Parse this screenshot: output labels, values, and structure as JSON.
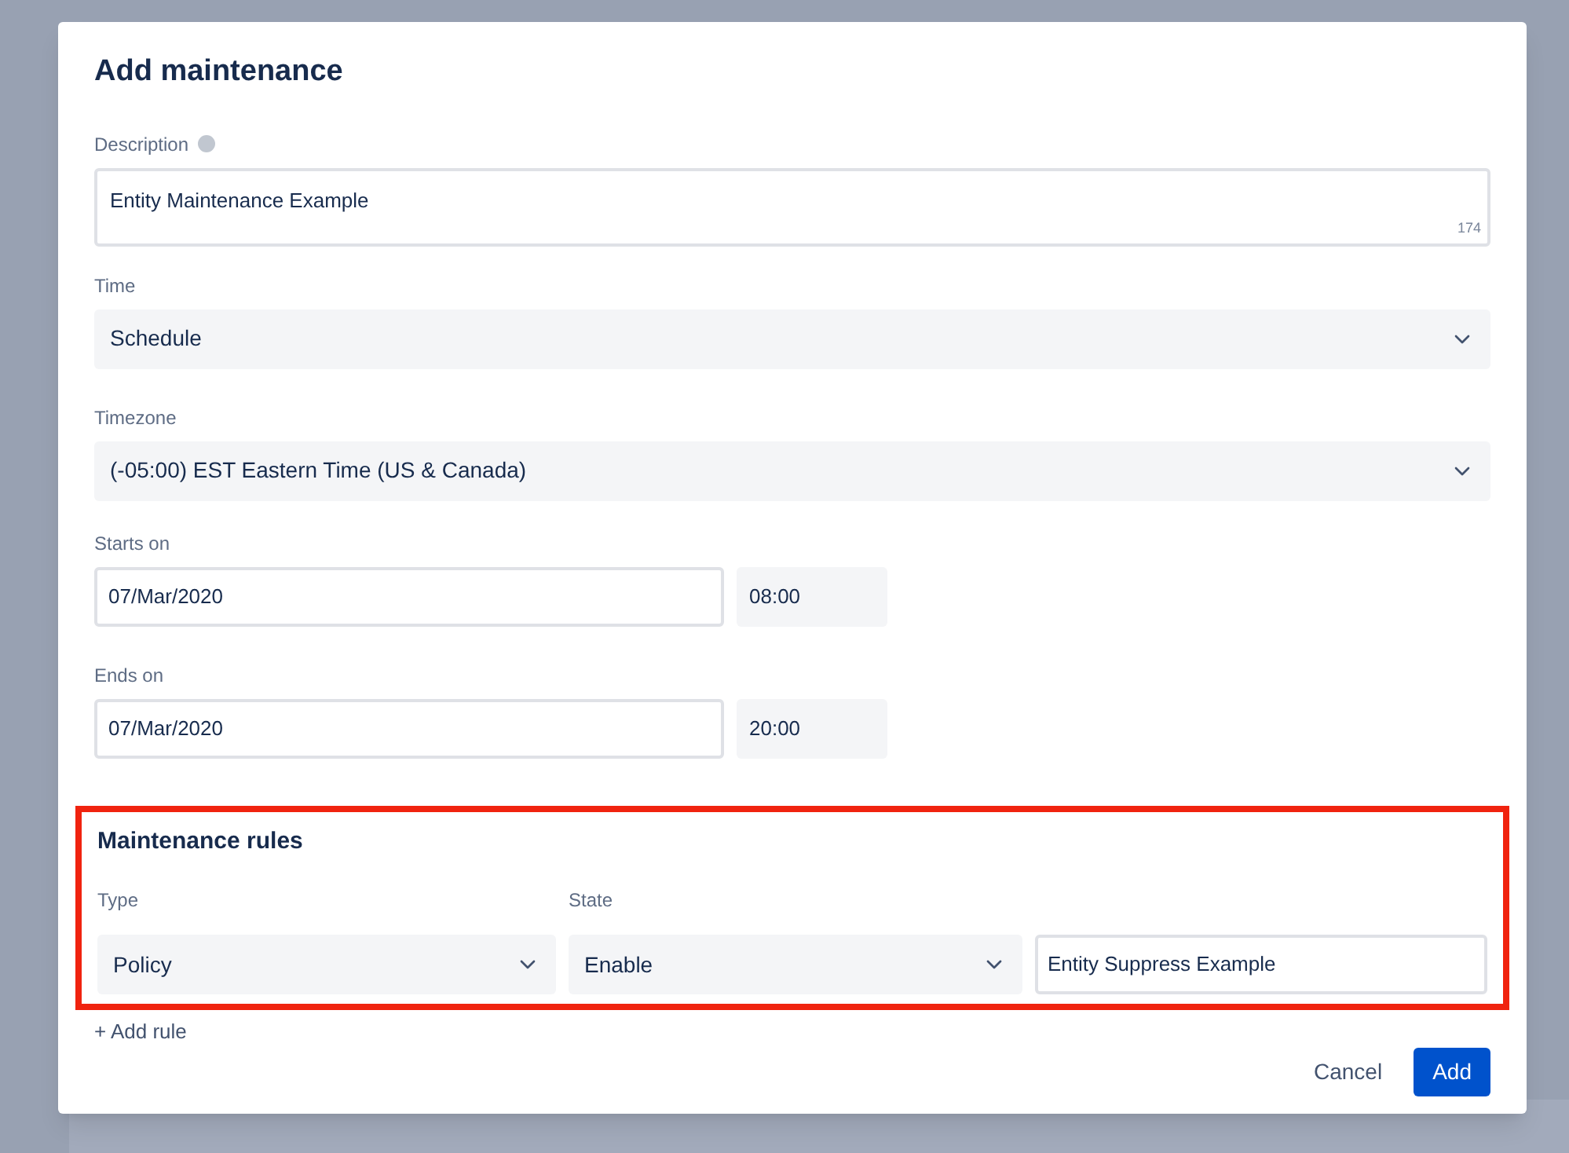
{
  "dialog": {
    "title": "Add maintenance",
    "description": {
      "label": "Description",
      "value": "Entity Maintenance Example",
      "counter": "174"
    },
    "time": {
      "label": "Time",
      "value": "Schedule"
    },
    "timezone": {
      "label": "Timezone",
      "value": "(-05:00) EST Eastern Time (US & Canada)"
    },
    "starts_on": {
      "label": "Starts on",
      "date": "07/Mar/2020",
      "time": "08:00"
    },
    "ends_on": {
      "label": "Ends on",
      "date": "07/Mar/2020",
      "time": "20:00"
    },
    "maintenance_rules": {
      "title": "Maintenance rules",
      "highlighted": true,
      "columns": [
        "Type",
        "State"
      ],
      "rules": [
        {
          "type": "Policy",
          "state": "Enable",
          "name": "Entity Suppress Example"
        }
      ],
      "add_rule": "+ Add rule"
    },
    "buttons": [
      {
        "label": "Cancel",
        "kind": "secondary"
      },
      {
        "label": "Add",
        "kind": "primary"
      }
    ]
  }
}
